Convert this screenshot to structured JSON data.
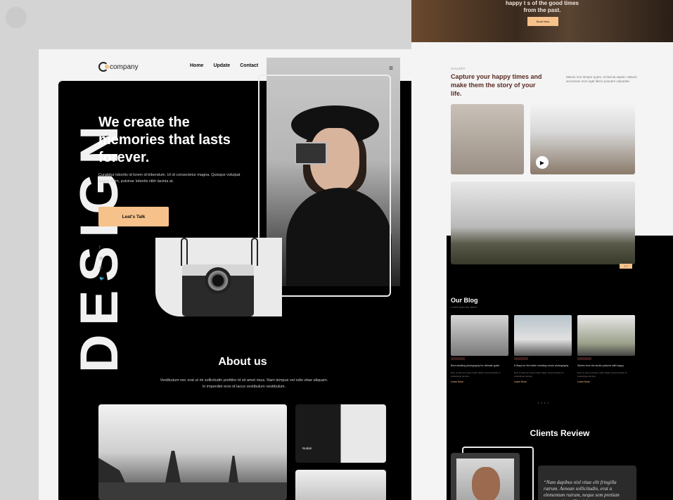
{
  "left": {
    "design_word": "DESIGN",
    "logo": "company",
    "logo_mark": "C",
    "nav": [
      "Home",
      "Update",
      "Contact"
    ],
    "menu_icon": "≡",
    "hero_title": "We create the memories that lasts forever.",
    "hero_desc": "Curabitur lobortis id lorem id bibendum. Ut id consectetur magna. Quisque volutpat augue enim, pulvinar lobortis nibh lacinia at.",
    "cta": "Leat's Talk",
    "socials": [
      "f",
      "◎",
      "℗",
      "🐦"
    ],
    "about_title": "About us",
    "about_desc": "Vestibulum nec erat ut mi sollicitudin porttitor id sit amet risus. Nam tempus vel odio vitae aliquam. In imperdiet eros id lacus vestibulum vestibulum.",
    "about_img2_label": "Nodari"
  },
  "right": {
    "top_text_1": "happy t s of the good times",
    "top_text_2": "from the past.",
    "top_button": "Book Now",
    "gallery_tag": "GALLERY",
    "gallery_title": "Capture your happy times and make them the story of your life.",
    "gallery_side": "Mauris non tempor quam, et lacinia sapien. Mauris accumsan eros eget libero posuere vulputate.",
    "play_icon": "▶",
    "arrows": "‹ ›",
    "blog_title": "Our Blog",
    "blog_sub": "Lorem ipsu dor amet",
    "blog_posts": [
      {
        "title": "Best wedding photography for ultimate guide",
        "text": "Duis ut risus at ornare mollis. Etiam porta tincidunt ut scelerisque tempus.",
        "more": "Learn More"
      },
      {
        "title": "8 Ways for the better wedding venue photography",
        "text": "Duis ut risus at ornare mollis. Etiam porta tincidunt ut scelerisque tempus.",
        "more": "Learn More"
      },
      {
        "title": "Stories from the studio pictures with happy",
        "text": "Duis ut risus at ornare mollis. Etiam porta tincidunt ut scelerisque tempus.",
        "more": "Learn More"
      }
    ],
    "blog_dots": "• • • •",
    "clients_title": "Clients Review",
    "quote": "“Nam dapibus nisl vitae elit fringilla rutrum. Aenean sollicitudin, erat a elementum rutrum, neque sem pretium metus, quis mollis nisl nunc et massa"
  }
}
